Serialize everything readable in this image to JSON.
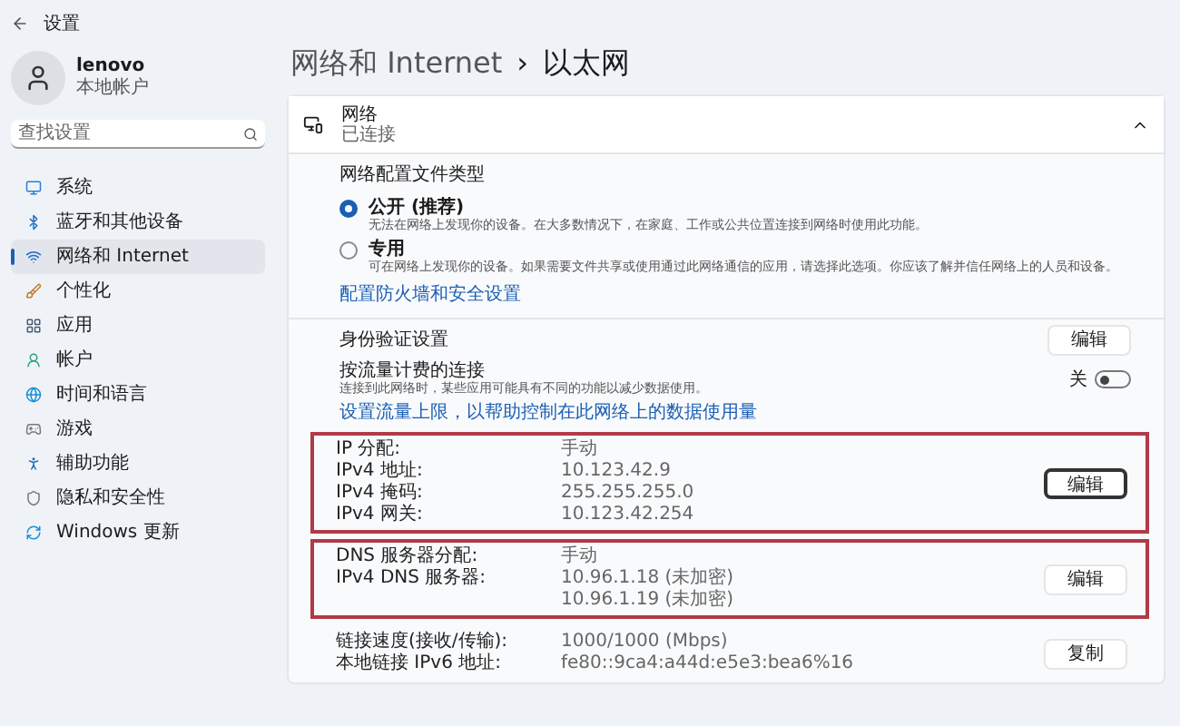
{
  "window": {
    "title": "设置"
  },
  "user": {
    "name": "lenovo",
    "account": "本地帐户"
  },
  "search": {
    "placeholder": "查找设置"
  },
  "sidebar": {
    "items": [
      {
        "label": "系统",
        "kind": "monitor",
        "selected": false
      },
      {
        "label": "蓝牙和其他设备",
        "kind": "bluetooth",
        "selected": false
      },
      {
        "label": "网络和 Internet",
        "kind": "wifi",
        "selected": true
      },
      {
        "label": "个性化",
        "kind": "brush",
        "selected": false
      },
      {
        "label": "应用",
        "kind": "apps",
        "selected": false
      },
      {
        "label": "帐户",
        "kind": "user",
        "selected": false
      },
      {
        "label": "时间和语言",
        "kind": "globe",
        "selected": false
      },
      {
        "label": "游戏",
        "kind": "gamepad",
        "selected": false
      },
      {
        "label": "辅助功能",
        "kind": "accessibility",
        "selected": false
      },
      {
        "label": "隐私和安全性",
        "kind": "shield",
        "selected": false
      },
      {
        "label": "Windows 更新",
        "kind": "update",
        "selected": false
      }
    ]
  },
  "breadcrumb": {
    "parent": "网络和 Internet",
    "separator": "›",
    "current": "以太网"
  },
  "network_card": {
    "title": "网络",
    "status": "已连接",
    "expanded": true
  },
  "profile": {
    "heading": "网络配置文件类型",
    "options": [
      {
        "label": "公开 (推荐)",
        "description": "无法在网络上发现你的设备。在大多数情况下，在家庭、工作或公共位置连接到网络时使用此功能。",
        "selected": true
      },
      {
        "label": "专用",
        "description": "可在网络上发现你的设备。如果需要文件共享或使用通过此网络通信的应用，请选择此选项。你应该了解并信任网络上的人员和设备。",
        "selected": false
      }
    ],
    "link": "配置防火墙和安全设置"
  },
  "auth": {
    "label": "身份验证设置",
    "button": "编辑"
  },
  "metered": {
    "label": "按流量计费的连接",
    "description": "连接到此网络时，某些应用可能具有不同的功能以减少数据使用。",
    "state_label": "关",
    "on": false,
    "link": "设置流量上限，以帮助控制在此网络上的数据使用量"
  },
  "ip_group": {
    "highlighted": true,
    "button": "编辑",
    "button_focused": true,
    "rows": [
      {
        "label": "IP 分配:",
        "values": [
          "手动"
        ]
      },
      {
        "label": "IPv4 地址:",
        "values": [
          "10.123.42.9"
        ]
      },
      {
        "label": "IPv4 掩码:",
        "values": [
          "255.255.255.0"
        ]
      },
      {
        "label": "IPv4 网关:",
        "values": [
          "10.123.42.254"
        ]
      }
    ]
  },
  "dns_group": {
    "highlighted": true,
    "button": "编辑",
    "button_focused": false,
    "rows": [
      {
        "label": "DNS 服务器分配:",
        "values": [
          "手动"
        ]
      },
      {
        "label": "IPv4 DNS 服务器:",
        "values": [
          "10.96.1.18 (未加密)",
          "10.96.1.19 (未加密)"
        ]
      }
    ]
  },
  "info_group": {
    "highlighted": false,
    "button": "复制",
    "button_focused": false,
    "rows": [
      {
        "label": "链接速度(接收/传输):",
        "values": [
          "1000/1000 (Mbps)"
        ]
      },
      {
        "label": "本地链接 IPv6 地址:",
        "values": [
          "fe80::9ca4:a44d:e5e3:bea6%16"
        ]
      }
    ]
  }
}
